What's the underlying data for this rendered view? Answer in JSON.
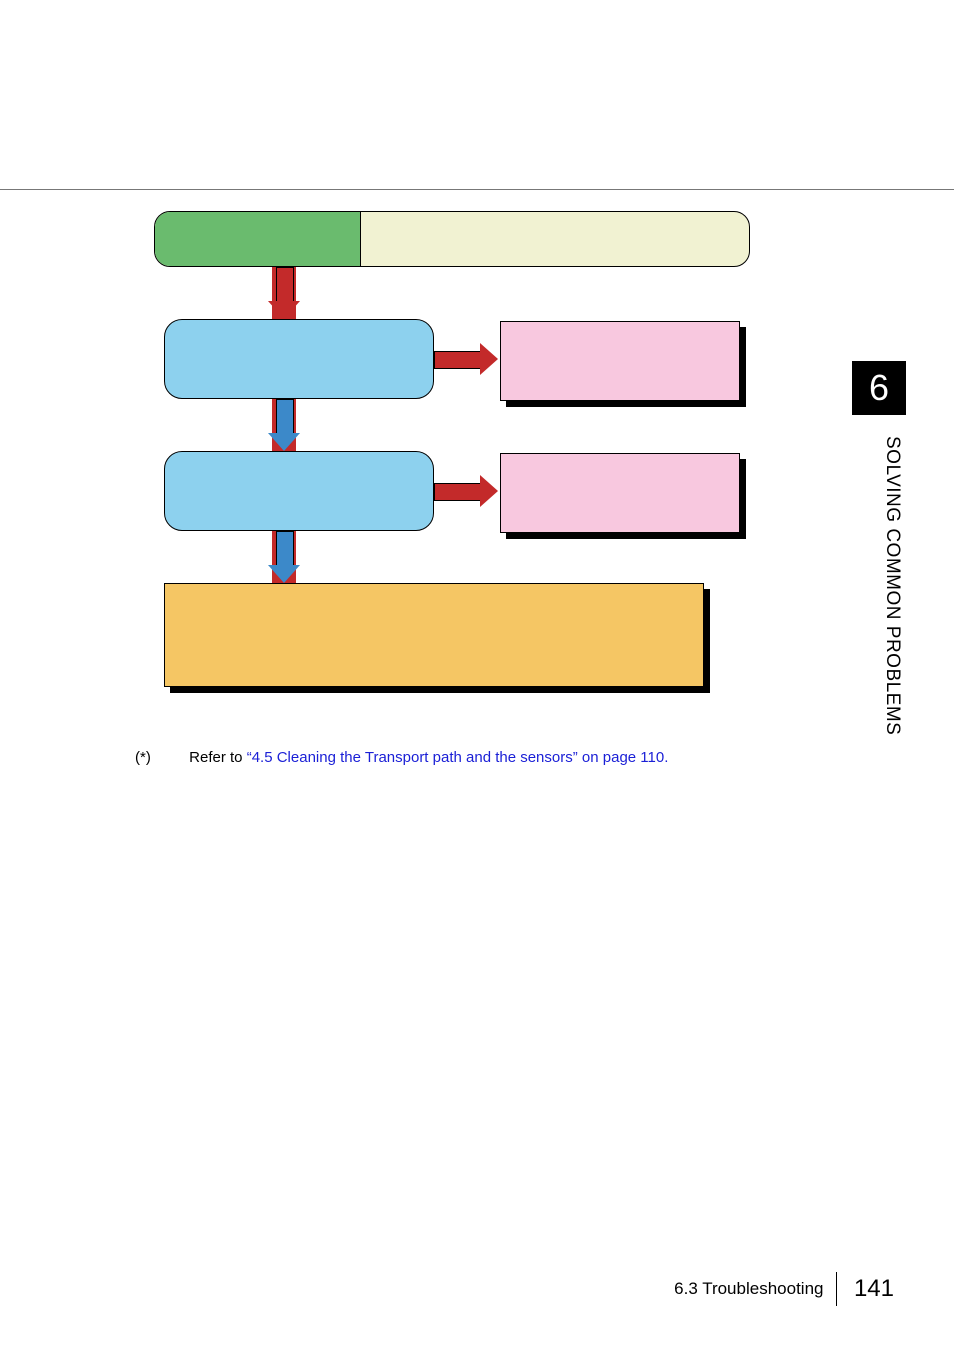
{
  "flow": {
    "top_left_label": "",
    "top_right_label": "",
    "step1_label": "",
    "step1_result_label": "",
    "step2_label": "",
    "step2_result_label": "",
    "outcome_label": ""
  },
  "footnote": {
    "marker": "(*)",
    "prefix": "Refer to ",
    "link_text": "“4.5 Cleaning the Transport path and the sensors” on page 110."
  },
  "side": {
    "chapter_number": "6",
    "chapter_title": "SOLVING COMMON PROBLEMS"
  },
  "footer": {
    "section": "6.3 Troubleshooting",
    "page": "141"
  }
}
